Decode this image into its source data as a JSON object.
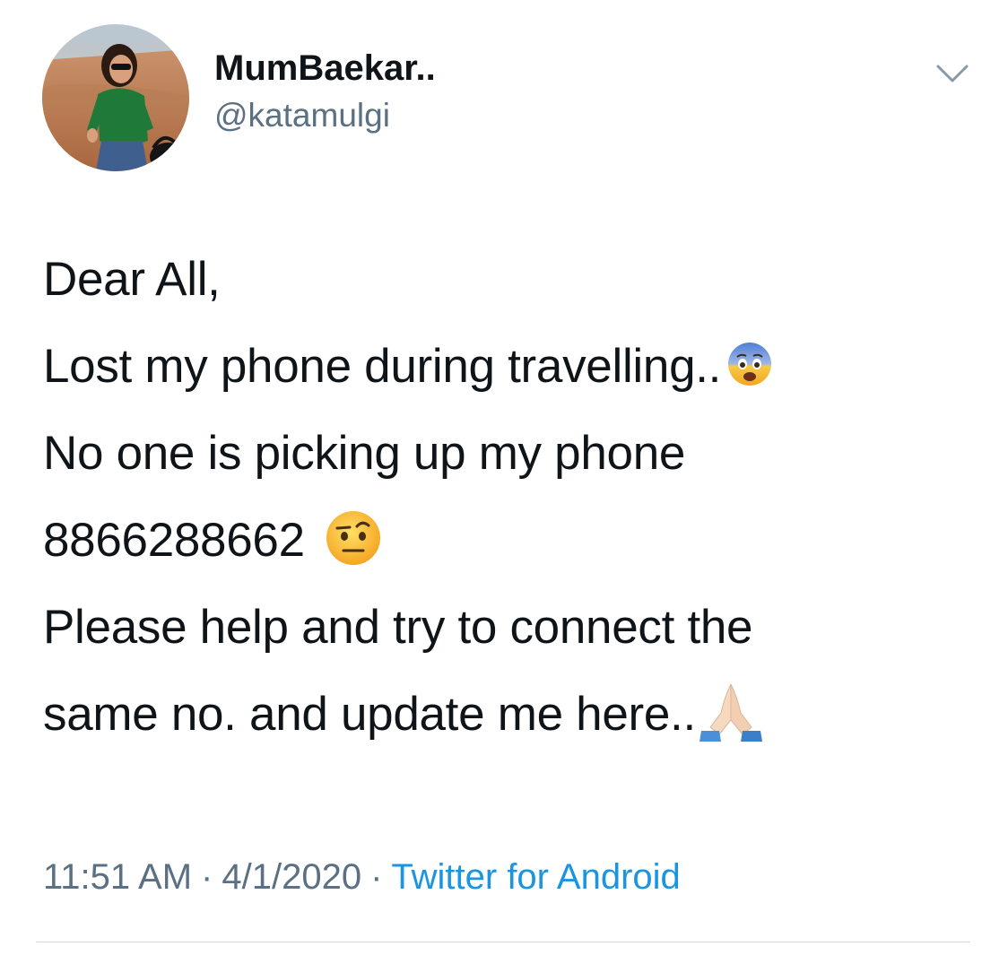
{
  "tweet": {
    "author": {
      "display_name": "MumBaekar..",
      "handle": "@katamulgi"
    },
    "body": {
      "line1": "Dear All,",
      "line2": "Lost my phone during travelling..",
      "line2_emoji": "fearful-face-emoji",
      "line3": "No one is picking up my phone",
      "line4": "8866288662",
      "line4_emoji": "face-with-raised-eyebrow-emoji",
      "line5": "Please help and try to connect the",
      "line6": "same no. and update me here..",
      "line6_emoji": "folded-hands-emoji"
    },
    "meta": {
      "time": "11:51 AM",
      "separator": "·",
      "date": "4/1/2020",
      "source": "Twitter for Android"
    },
    "icons": {
      "menu": "chevron-down-icon"
    },
    "colors": {
      "text": "#0f1419",
      "secondary": "#5b7083",
      "link": "#1b95e0",
      "divider": "#cfd9de"
    }
  }
}
